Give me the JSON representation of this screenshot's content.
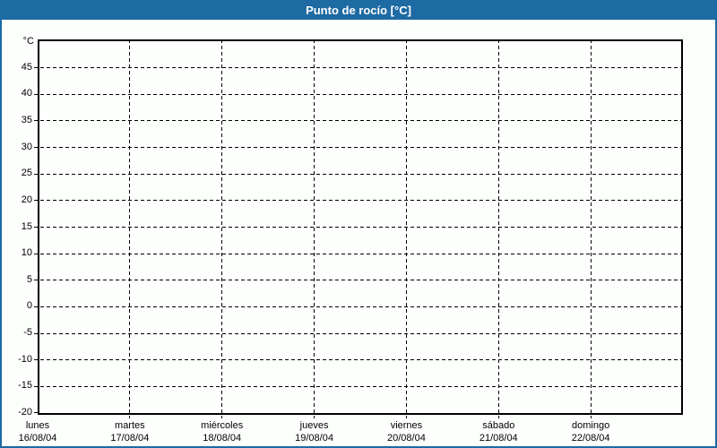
{
  "header": {
    "title": "Punto de rocío [°C]"
  },
  "colors": {
    "accent_blue": "#1e6aa3",
    "background": "#fdfffd",
    "grid": "#000000",
    "title_text": "#ffffff"
  },
  "chart_data": {
    "type": "line",
    "title": "Punto de rocío [°C]",
    "ylabel": "°C",
    "xlabel": "",
    "ylim": [
      -20,
      50
    ],
    "ytick_step": 5,
    "ytick_labels": [
      45,
      40,
      35,
      30,
      25,
      20,
      15,
      10,
      5,
      0,
      -5,
      -10,
      -15,
      -20
    ],
    "grid": "dashed",
    "legend_position": "none",
    "x_categories": [
      {
        "day": "lunes",
        "date": "16/08/04"
      },
      {
        "day": "martes",
        "date": "17/08/04"
      },
      {
        "day": "miércoles",
        "date": "18/08/04"
      },
      {
        "day": "jueves",
        "date": "19/08/04"
      },
      {
        "day": "viernes",
        "date": "20/08/04"
      },
      {
        "day": "sábado",
        "date": "21/08/04"
      },
      {
        "day": "domingo",
        "date": "22/08/04"
      }
    ],
    "series": []
  }
}
